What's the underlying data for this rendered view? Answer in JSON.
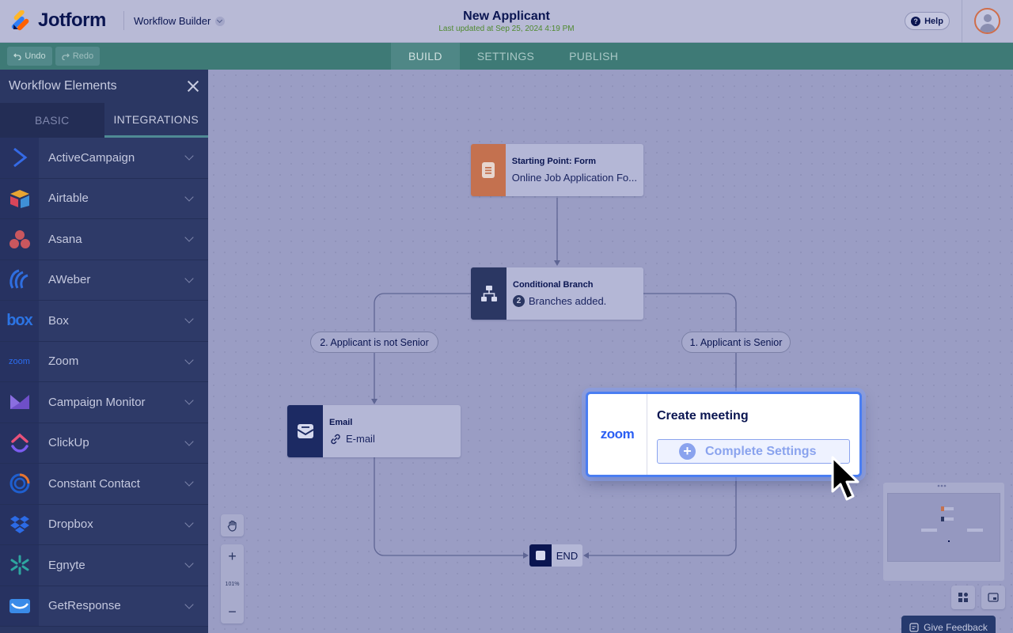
{
  "header": {
    "logo_text": "Jotform",
    "workflow_builder": "Workflow Builder",
    "title": "New Applicant",
    "subtitle": "Last updated at Sep 25, 2024 4:19 PM",
    "help": "Help"
  },
  "toolbar": {
    "undo": "Undo",
    "redo": "Redo",
    "tabs": [
      "BUILD",
      "SETTINGS",
      "PUBLISH"
    ],
    "active_tab": "BUILD"
  },
  "sidebar": {
    "title": "Workflow Elements",
    "tabs": [
      "BASIC",
      "INTEGRATIONS"
    ],
    "active_tab": "INTEGRATIONS",
    "items": [
      {
        "label": "ActiveCampaign",
        "icon": "activecampaign-icon"
      },
      {
        "label": "Airtable",
        "icon": "airtable-icon"
      },
      {
        "label": "Asana",
        "icon": "asana-icon"
      },
      {
        "label": "AWeber",
        "icon": "aweber-icon"
      },
      {
        "label": "Box",
        "icon": "box-icon"
      },
      {
        "label": "Zoom",
        "icon": "zoom-icon"
      },
      {
        "label": "Campaign Monitor",
        "icon": "campaign-monitor-icon"
      },
      {
        "label": "ClickUp",
        "icon": "clickup-icon"
      },
      {
        "label": "Constant Contact",
        "icon": "constant-contact-icon"
      },
      {
        "label": "Dropbox",
        "icon": "dropbox-icon"
      },
      {
        "label": "Egnyte",
        "icon": "egnyte-icon"
      },
      {
        "label": "GetResponse",
        "icon": "getresponse-icon"
      }
    ],
    "icon_text": {
      "box": "box",
      "zoom": "zoom"
    }
  },
  "canvas": {
    "start_node": {
      "title": "Starting Point: Form",
      "subtitle": "Online Job Application Fo..."
    },
    "branch_node": {
      "title": "Conditional Branch",
      "badge": "2",
      "subtitle": "Branches added."
    },
    "branch_left_label": "2. Applicant is not Senior",
    "branch_right_label": "1. Applicant is Senior",
    "email_node": {
      "title": "Email",
      "subtitle": "E-mail"
    },
    "zoom_card": {
      "logo": "zoom",
      "title": "Create meeting",
      "button": "Complete Settings"
    },
    "end_node": "END",
    "zoom_level": "101%",
    "feedback": "Give Feedback"
  },
  "colors": {
    "accent_blue": "#4a7ef2",
    "form_orange": "#c4714f",
    "navy": "#0a1551",
    "sidebar_bg": "#2b3763",
    "toolbar_teal": "#3e7a76"
  }
}
